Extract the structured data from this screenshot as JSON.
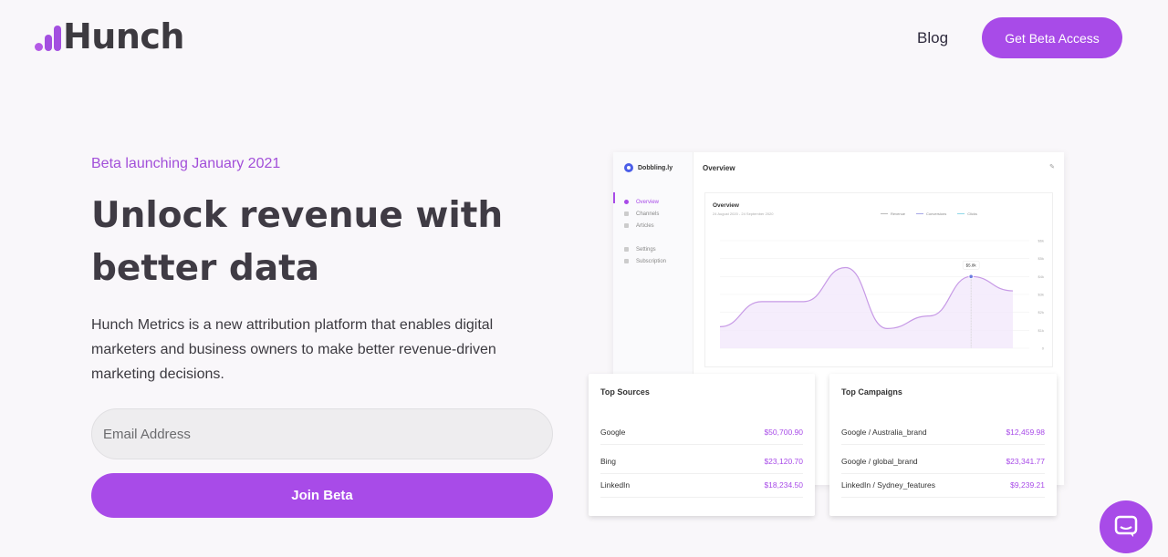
{
  "header": {
    "logo_text": "Hunch",
    "nav_blog": "Blog",
    "cta_label": "Get Beta Access"
  },
  "hero": {
    "eyebrow": "Beta launching January 2021",
    "headline": "Unlock revenue with better data",
    "description": "Hunch Metrics is a new attribution platform that enables digital marketers and business owners to make better revenue-driven marketing decisions.",
    "email_placeholder": "Email Address",
    "join_label": "Join Beta"
  },
  "dashboard": {
    "brand": "Dobbling.ly",
    "title": "Overview",
    "nav": [
      "Overview",
      "Channels",
      "Articles",
      "Settings",
      "Subscription"
    ],
    "chart": {
      "title": "Overview",
      "subtitle": "24 August 2020 - 24 September 2020",
      "legend": [
        "Revenue",
        "Conversions",
        "Clicks"
      ],
      "tooltip": "$5.8k",
      "values": [
        1.2,
        2.6,
        2.6,
        4.5,
        1.1,
        1.8,
        4.0,
        3.2
      ],
      "y_ticks": [
        "$6k",
        "$5k",
        "$4k",
        "$3k",
        "$2k",
        "$1k",
        "0"
      ]
    },
    "accent_color": "#a84be8"
  },
  "top_sources": {
    "title": "Top Sources",
    "rows": [
      {
        "name": "Google",
        "value": "$50,700.90"
      },
      {
        "name": "Bing",
        "value": "$23,120.70"
      },
      {
        "name": "LinkedIn",
        "value": "$18,234.50"
      }
    ]
  },
  "top_campaigns": {
    "title": "Top Campaigns",
    "rows": [
      {
        "name": "Google / Australia_brand",
        "value": "$12,459.98"
      },
      {
        "name": "Google / global_brand",
        "value": "$23,341.77"
      },
      {
        "name": "LinkedIn / Sydney_features",
        "value": "$9,239.21"
      }
    ]
  },
  "chat": {
    "icon": "chat-bubble-icon"
  }
}
